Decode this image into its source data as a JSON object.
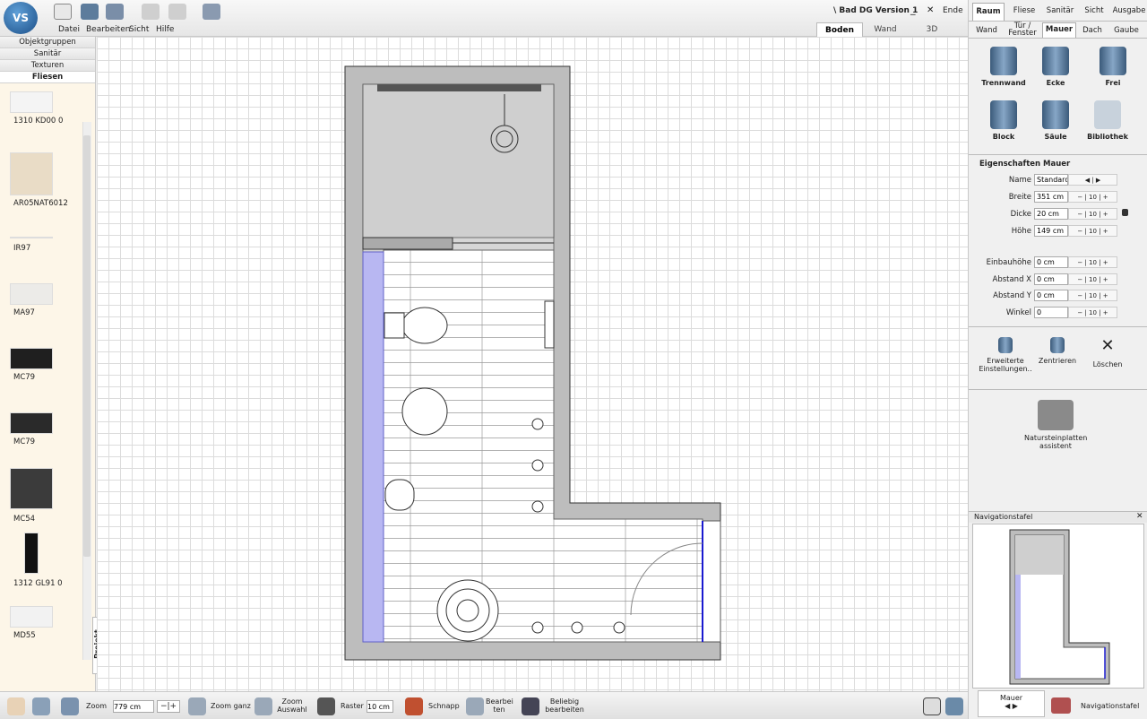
{
  "app": {
    "title": "\\ Bad DG Version 1",
    "exit_label": "Ende",
    "minimize_glyph": "_",
    "close_glyph": "✕"
  },
  "menu": [
    "Datei",
    "Bearbeiten",
    "Sicht",
    "Hilfe"
  ],
  "view_tabs": [
    "Boden",
    "Wand",
    "3D"
  ],
  "left": {
    "categories": [
      "Objektgruppen",
      "Sanitär",
      "Texturen",
      "Fliesen"
    ],
    "tiles": [
      {
        "label": "1310 KD00 0",
        "color": "#f4f4f4"
      },
      {
        "label": "AR05NAT6012",
        "color": "#e9dcc6"
      },
      {
        "label": "IR97",
        "color": "#cfe3ea"
      },
      {
        "label": "MA97",
        "color": "#ecebe8"
      },
      {
        "label": "MC79",
        "color": "#1f1f1f"
      },
      {
        "label": "MC79",
        "color": "#2a2a2a"
      },
      {
        "label": "MC54",
        "color": "#3b3b3b"
      },
      {
        "label": "1312 GL91 0",
        "color": "#111111"
      },
      {
        "label": "MD55",
        "color": "#f2f2f2"
      }
    ],
    "projekt_tab": "Projekt"
  },
  "right": {
    "main_tabs": [
      "Raum",
      "Fliese",
      "Sanitär",
      "Sicht",
      "Ausgabe"
    ],
    "sub_tabs": [
      "Wand",
      "Tür / Fenster",
      "Mauer",
      "Dach",
      "Gaube"
    ],
    "wall_types": [
      "Trennwand",
      "Ecke",
      "Frei",
      "Block",
      "Säule",
      "Bibliothek"
    ],
    "props_title": "Eigenschaften Mauer",
    "props": [
      {
        "label": "Name",
        "value": "Standard M"
      },
      {
        "label": "Breite",
        "value": "351 cm",
        "step": "10"
      },
      {
        "label": "Dicke",
        "value": "20 cm",
        "step": "10"
      },
      {
        "label": "Höhe",
        "value": "149 cm",
        "step": "10"
      },
      {
        "label": "Einbauhöhe",
        "value": "0 cm",
        "step": "10"
      },
      {
        "label": "Abstand X",
        "value": "0 cm",
        "step": "10"
      },
      {
        "label": "Abstand Y",
        "value": "0 cm",
        "step": "10"
      },
      {
        "label": "Winkel",
        "value": "0",
        "step": "10"
      }
    ],
    "actions": [
      "Erweiterte Einstellungen..",
      "Zentrieren",
      "Löschen"
    ],
    "natur": "Natursteinplatten assistent",
    "nav_title": "Navigationstafel",
    "bottom_tabs": [
      "Mauer",
      "Navigationstafel"
    ]
  },
  "bottom": {
    "zoom_label": "Zoom",
    "zoom_value": "779 cm",
    "zoom_ganz": "Zoom ganz",
    "zoom_auswahl": "Zoom Auswahl",
    "raster_label": "Raster",
    "raster_value": "10 cm",
    "schnapp": "Schnapp",
    "bearbeiten": "Bearbei ten",
    "beliebig": "Beliebig bearbeiten"
  }
}
